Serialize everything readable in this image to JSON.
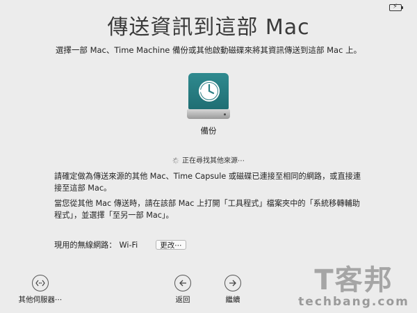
{
  "window": {
    "title": "傳送資訊到這部 Mac",
    "subtitle": "選擇一部 Mac、Time Machine 備份或其他啟動磁碟來將其資訊傳送到這部 Mac 上。"
  },
  "source": {
    "label": "備份",
    "icon": "time-machine-drive-icon"
  },
  "status": {
    "searching": "正在尋找其他來源⋯"
  },
  "instructions": {
    "p1": "請確定做為傳送來源的其他 Mac、Time Capsule 或磁碟已連接至相同的網路，或直接連接至這部 Mac。",
    "p2": "當您從其他 Mac 傳送時，請在該部 Mac 上打開「工具程式」檔案夾中的「系統移轉輔助程式」，並選擇「至另一部 Mac」。"
  },
  "network": {
    "label": "現用的無線網路：",
    "value": "Wi-Fi",
    "change_label": "更改⋯"
  },
  "nav": {
    "other_servers": "其他伺服器⋯",
    "back": "返回",
    "continue": "繼續"
  },
  "watermark": {
    "cn": "T客邦",
    "en": "techbang.com"
  },
  "colors": {
    "drive": "#2a7f84",
    "background": "#ececec"
  }
}
